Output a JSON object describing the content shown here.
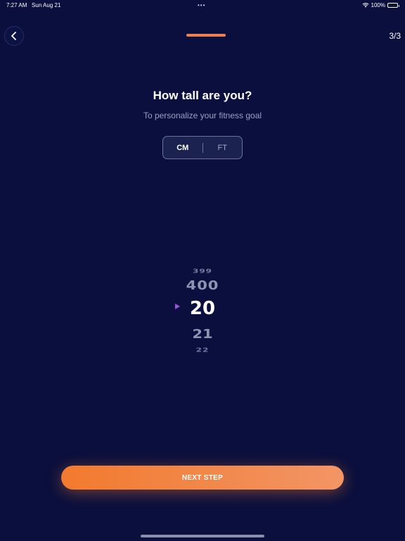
{
  "status_bar": {
    "time": "7:27 AM",
    "date": "Sun Aug 21",
    "dots": "•••",
    "battery": "100%",
    "icons": [
      "wifi-icon",
      "battery-icon"
    ]
  },
  "header": {
    "back_icon": "chevron-left-icon",
    "step": "3/3",
    "progress_color": "#f08050"
  },
  "content": {
    "title": "How tall are you?",
    "subtitle": "To personalize your fitness goal"
  },
  "unit_toggle": {
    "options": [
      "CM",
      "FT"
    ],
    "selected": "CM"
  },
  "picker": {
    "values": [
      "399",
      "400",
      "20",
      "21",
      "22"
    ],
    "selected": "20",
    "indicator_color": "#a14fe0"
  },
  "actions": {
    "next_label": "NEXT STEP",
    "accent": "#f37a2e"
  },
  "colors": {
    "background": "#0a0f3d"
  }
}
